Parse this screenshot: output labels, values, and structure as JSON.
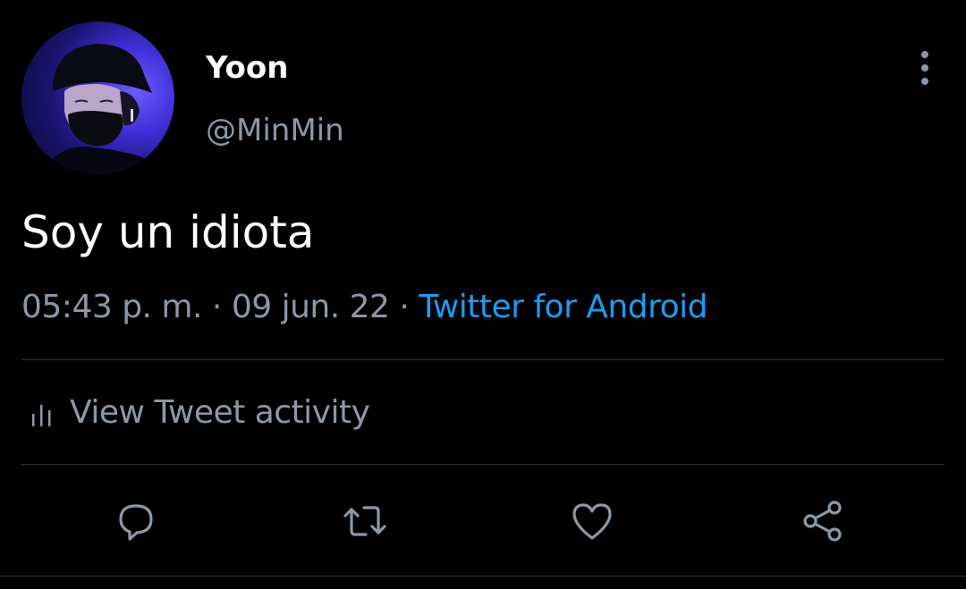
{
  "tweet": {
    "author": {
      "display_name": "Yoon",
      "handle": "@MinMin",
      "avatar_icon": "profile-photo"
    },
    "text": "Soy un idiota",
    "timestamp": {
      "time": "05:43 p. m.",
      "separator": "·",
      "date": "09 jun. 22",
      "source": "Twitter for Android"
    },
    "activity_label": "View Tweet activity",
    "actions": [
      {
        "icon": "reply-icon"
      },
      {
        "icon": "retweet-icon"
      },
      {
        "icon": "like-icon"
      },
      {
        "icon": "share-icon"
      }
    ],
    "more_icon": "more-vertical-icon"
  },
  "colors": {
    "background": "#000000",
    "primary_text": "#ffffff",
    "secondary_text": "#8b98a5",
    "link": "#1d9bf0",
    "divider": "#2f3336"
  }
}
